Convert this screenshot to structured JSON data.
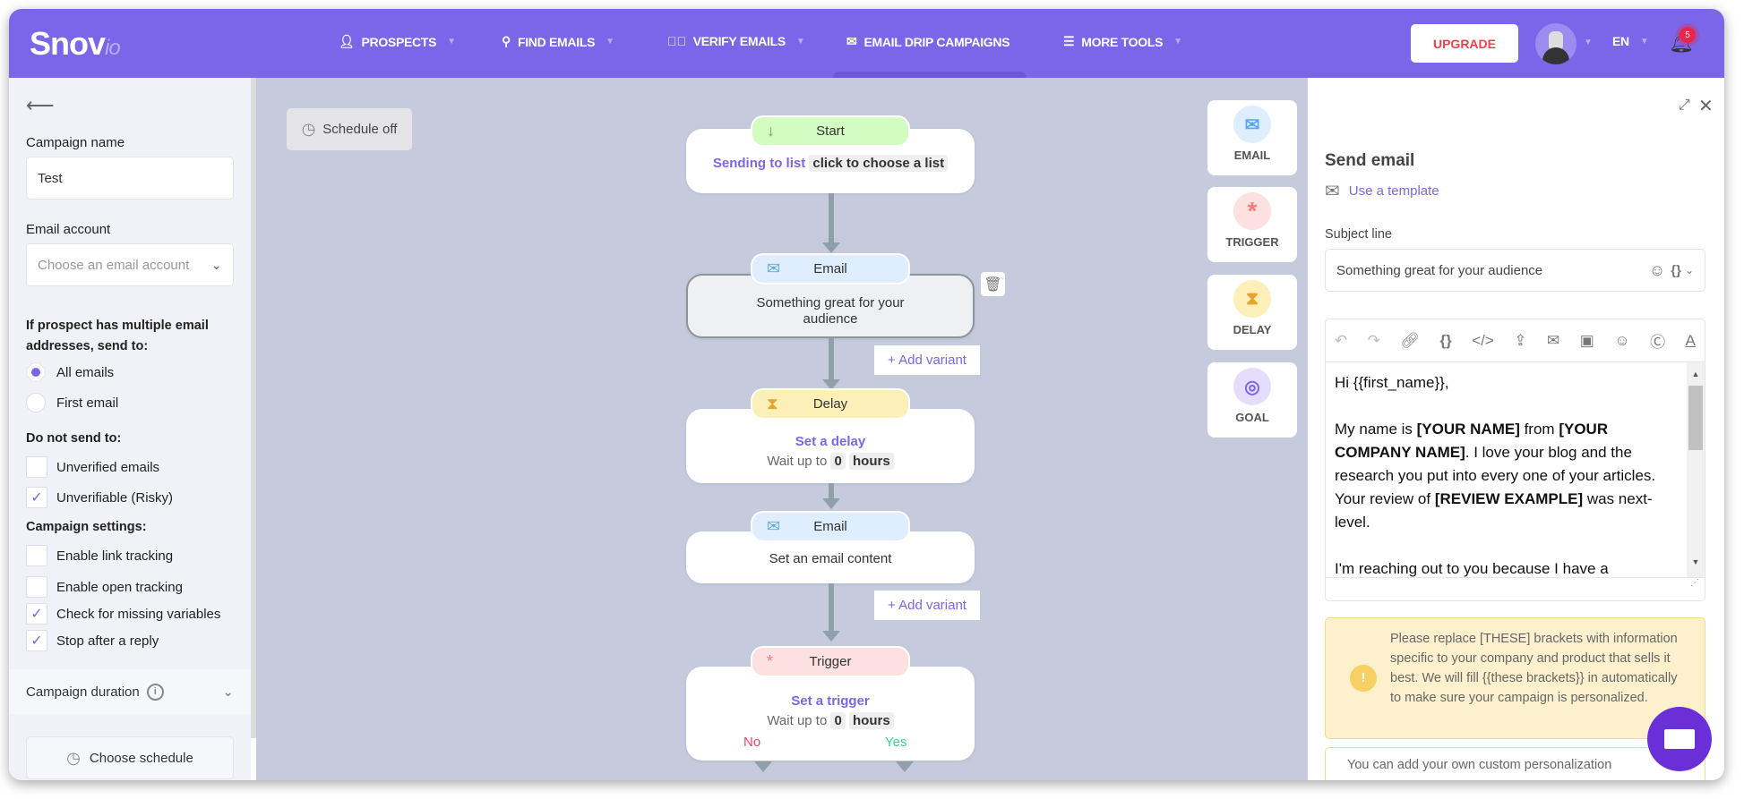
{
  "header": {
    "logo": "Snov",
    "logo_suffix": "io",
    "nav": [
      {
        "label": "PROSPECTS",
        "icon": "person-icon"
      },
      {
        "label": "FIND EMAILS",
        "icon": "search-icon"
      },
      {
        "label": "VERIFY EMAILS",
        "icon": "check-circle-icon"
      },
      {
        "label": "EMAIL DRIP CAMPAIGNS",
        "icon": "envelope-icon"
      },
      {
        "label": "MORE TOOLS",
        "icon": "menu-icon"
      }
    ],
    "upgrade": "UPGRADE",
    "lang": "EN",
    "notifications": "5",
    "accent": "#7b66ea"
  },
  "left": {
    "campaign_name_label": "Campaign name",
    "campaign_name": "Test",
    "email_account_label": "Email account",
    "email_account_placeholder": "Choose an email account",
    "multi_label": "If prospect has multiple email addresses, send to:",
    "radios": [
      {
        "label": "All emails",
        "checked": true
      },
      {
        "label": "First email",
        "checked": false
      }
    ],
    "dns_label": "Do not send to:",
    "dns": [
      {
        "label": "Unverified emails",
        "checked": false
      },
      {
        "label": "Unverifiable (Risky)",
        "checked": true
      }
    ],
    "settings_label": "Campaign settings:",
    "settings": [
      {
        "label": "Enable link tracking",
        "checked": false
      },
      {
        "label": "Enable open tracking",
        "checked": false
      },
      {
        "label": "Check for missing variables",
        "checked": true
      },
      {
        "label": "Stop after a reply",
        "checked": true
      }
    ],
    "duration_label": "Campaign duration",
    "choose_schedule": "Choose schedule"
  },
  "canvas": {
    "schedule": "Schedule off",
    "start": {
      "title": "Start",
      "link": "Sending to list",
      "tag": "click to choose a list"
    },
    "email1": {
      "title": "Email",
      "text": "Something great for your audience"
    },
    "add_variant": "+ Add variant",
    "delay": {
      "title": "Delay",
      "link": "Set a delay",
      "wait": "Wait up to",
      "value": "0",
      "unit": "hours"
    },
    "email2": {
      "title": "Email",
      "text": "Set an email content"
    },
    "trigger": {
      "title": "Trigger",
      "link": "Set a trigger",
      "wait": "Wait up to",
      "value": "0",
      "unit": "hours",
      "no": "No",
      "yes": "Yes"
    },
    "palette": [
      {
        "label": "EMAIL",
        "icon": "envelope-icon"
      },
      {
        "label": "TRIGGER",
        "icon": "asterisk-icon"
      },
      {
        "label": "DELAY",
        "icon": "hourglass-icon"
      },
      {
        "label": "GOAL",
        "icon": "target-icon"
      }
    ]
  },
  "right": {
    "title": "Send email",
    "template": "Use a template",
    "subject_label": "Subject line",
    "subject": "Something great for your audience",
    "body": {
      "greeting": "Hi {{first_name}},",
      "p1a": "My name is ",
      "b1": "[YOUR NAME]",
      "p1b": " from ",
      "b2": "[YOUR COMPANY NAME]",
      "p1c": ". I love your blog and the research you put into every one of your articles. Your review of ",
      "b3": "[REVIEW EXAMPLE]",
      "p1d": " was next-level.",
      "p2": "I'm reaching out to you because I have a"
    },
    "warning": "Please replace [THESE] brackets with information specific to your company and product that sells it best. We will fill {{these brackets}} in automatically to make sure your campaign is personalized.",
    "custom": "You can add your own custom personalization"
  }
}
